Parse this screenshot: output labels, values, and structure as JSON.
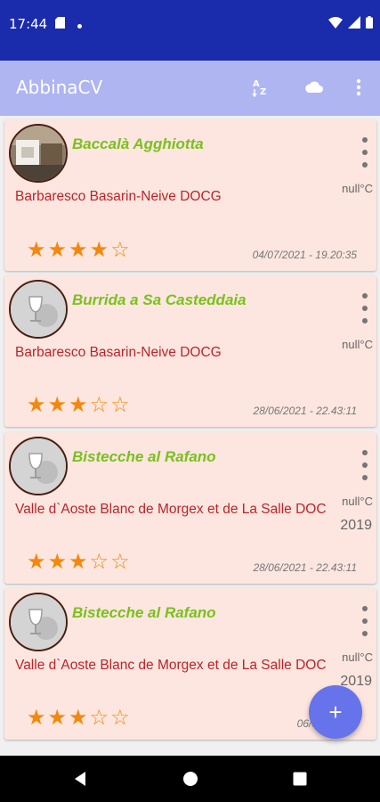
{
  "status_bar": {
    "time": "17:44",
    "icons": [
      "sd-card-icon",
      "notification-dot-icon",
      "wifi-icon",
      "signal-icon",
      "battery-icon"
    ]
  },
  "app_bar": {
    "title": "AbbinaCV",
    "actions": [
      "sort-az-icon",
      "cloud-icon",
      "more-vert-icon"
    ],
    "background": "#aeb5f1"
  },
  "colors": {
    "status_bar": "#1a2bab",
    "card_background": "#fce6df",
    "dish_name": "#7ac01e",
    "wine_text": "#b8252b",
    "stars": "#f5870c",
    "fab": "#6673ea"
  },
  "cards": [
    {
      "dish": "Baccalà Agghiotta",
      "wine": "Barbaresco Basarin-Neive DOCG",
      "temperature": "null°C",
      "year": "",
      "rating": 4,
      "max_rating": 5,
      "date": "04/07/2021 - 19.20:35",
      "avatar": "photo"
    },
    {
      "dish": "Burrida a Sa Casteddaia",
      "wine": "Barbaresco Basarin-Neive DOCG",
      "temperature": "null°C",
      "year": "",
      "rating": 3,
      "max_rating": 5,
      "date": "28/06/2021 - 22.43:11",
      "avatar": "wine-glass-placeholder"
    },
    {
      "dish": "Bistecche al Rafano",
      "wine": "Valle d`Aoste Blanc de Morgex et de La Salle DOC",
      "temperature": "null°C",
      "year": "2019",
      "rating": 3,
      "max_rating": 5,
      "date": "28/06/2021 - 22.43:11",
      "avatar": "wine-glass-placeholder"
    },
    {
      "dish": "Bistecche al Rafano",
      "wine": "Valle d`Aoste Blanc de Morgex et de La Salle DOC",
      "temperature": "null°C",
      "year": "2019",
      "rating": 3,
      "max_rating": 5,
      "date": "06/07/2021 - ",
      "avatar": "wine-glass-placeholder"
    }
  ],
  "fab": {
    "label": "+"
  }
}
